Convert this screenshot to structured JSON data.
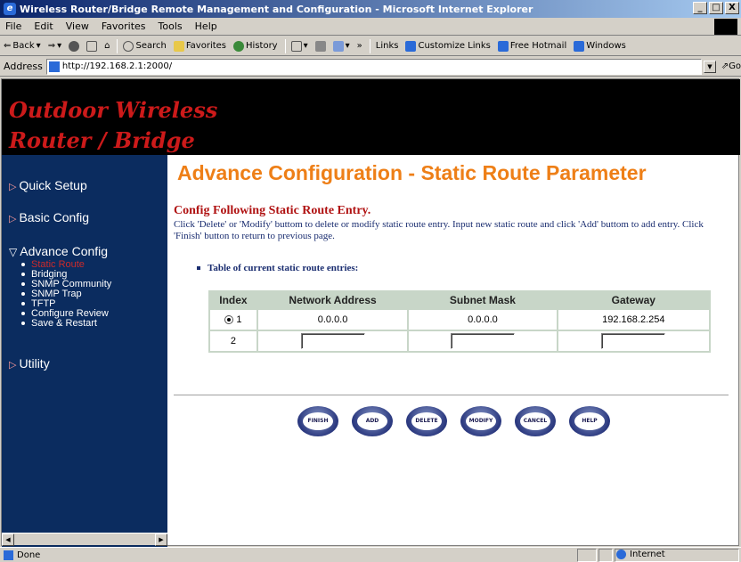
{
  "window": {
    "title": "Wireless Router/Bridge Remote Management and Configuration - Microsoft Internet Explorer",
    "minimize": "_",
    "maximize": "□",
    "close": "X"
  },
  "menu": [
    "File",
    "Edit",
    "View",
    "Favorites",
    "Tools",
    "Help"
  ],
  "toolbar": {
    "back": "Back",
    "search": "Search",
    "favorites": "Favorites",
    "history": "History",
    "links": "Links",
    "customize": "Customize Links",
    "hotmail": "Free Hotmail",
    "windows": "Windows"
  },
  "address": {
    "label": "Address",
    "url": "http://192.168.2.1:2000/",
    "go": "Go"
  },
  "banner": {
    "line1": "Outdoor Wireless",
    "line2": "Router / Bridge"
  },
  "sidebar": {
    "quick_setup": "Quick Setup",
    "basic_config": "Basic Config",
    "advance_config": "Advance Config",
    "utility": "Utility",
    "sub_items": [
      "Static Route",
      "Bridging",
      "SNMP Community",
      "SNMP Trap",
      "TFTP",
      "Configure Review",
      "Save & Restart"
    ]
  },
  "main": {
    "heading": "Advance Configuration - Static Route Parameter",
    "subheading": "Config Following Static Route Entry.",
    "description": "Click 'Delete' or 'Modify' buttom to delete or modify static route entry. Input new static route and click 'Add' buttom to add entry. Click 'Finish' button to return to previous page.",
    "table_label": "Table of current static route entries:",
    "columns": [
      "Index",
      "Network Address",
      "Subnet Mask",
      "Gateway"
    ],
    "rows": [
      {
        "index": "1",
        "network": "0.0.0.0",
        "mask": "0.0.0.0",
        "gateway": "192.168.2.254"
      },
      {
        "index": "2",
        "network": "",
        "mask": "",
        "gateway": ""
      }
    ],
    "buttons": [
      "FINISH",
      "ADD",
      "DELETE",
      "MODIFY",
      "CANCEL",
      "HELP"
    ]
  },
  "status": {
    "left": "Done",
    "zone": "Internet"
  },
  "colors": {
    "heading": "#ee7f17",
    "sidebar_bg": "#0b2c5f",
    "banner_text": "#cc1a1a"
  }
}
